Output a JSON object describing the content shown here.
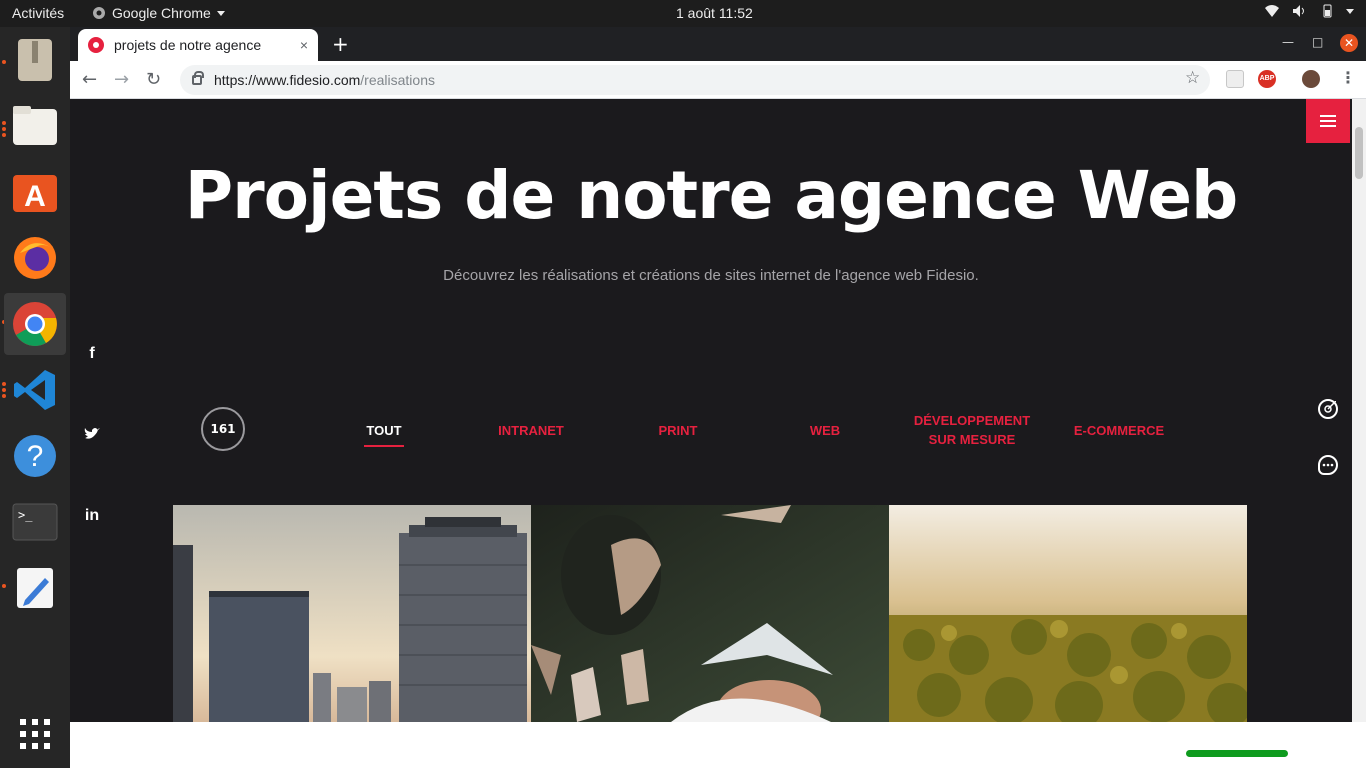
{
  "topbar": {
    "activities": "Activités",
    "app_name": "Google Chrome",
    "clock": "1 août  11:52"
  },
  "dock": {
    "items": [
      "archive-manager",
      "files",
      "ubuntu-software",
      "firefox",
      "chrome",
      "vscode",
      "help",
      "terminal",
      "text-editor"
    ],
    "show_apps": "show-applications"
  },
  "browser": {
    "tab_title": "projets de notre agence",
    "url_host": "https://www.fidesio.com",
    "url_path": "/realisations",
    "new_tab": "+",
    "close": "×",
    "ext_abp": "ABP"
  },
  "page": {
    "title": "Projets de notre agence Web",
    "subtitle": "Découvrez les réalisations et créations de sites internet de l'agence web Fidesio.",
    "social": [
      "f",
      "t",
      "in"
    ],
    "counter": "161",
    "filters": [
      {
        "label": "TOUT",
        "active": true
      },
      {
        "label": "INTRANET",
        "active": false
      },
      {
        "label": "PRINT",
        "active": false
      },
      {
        "label": "WEB",
        "active": false
      },
      {
        "label": "DÉVELOPPEMENT SUR MESURE",
        "active": false
      },
      {
        "label": "E-COMMERCE",
        "active": false
      }
    ],
    "accent_color": "#e6213f",
    "background_color": "#1b1a1d"
  }
}
